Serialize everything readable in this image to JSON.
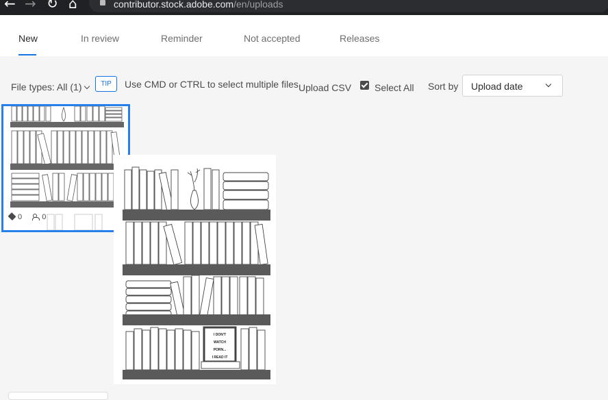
{
  "browser": {
    "url_host": "contributor.stock.adobe.com",
    "url_path": "/en/uploads",
    "back_glyph": "←",
    "forward_glyph": "→",
    "reload_glyph": "↻",
    "home_glyph": "⌂"
  },
  "tabs": [
    {
      "label": "New",
      "active": true
    },
    {
      "label": "In review",
      "active": false
    },
    {
      "label": "Reminder",
      "active": false
    },
    {
      "label": "Not accepted",
      "active": false
    },
    {
      "label": "Releases",
      "active": false
    }
  ],
  "toolbar": {
    "file_types_label": "File types: All (1)",
    "tip_label": "TIP",
    "tip_text": "Use CMD or CTRL to select multiple files",
    "upload_csv_label": "Upload CSV",
    "select_all_label": "Select All",
    "select_all_checked": true,
    "sort_by_label": "Sort by",
    "sort_value": "Upload date"
  },
  "thumbnail": {
    "keywords_count": "0",
    "releases_count": "0",
    "selected": true
  },
  "preview": {
    "sign_text": [
      "I DON'T",
      "WATCH",
      "PORN...",
      "I READ IT"
    ]
  },
  "colors": {
    "accent": "#1473e6",
    "selection": "#2680eb",
    "background": "#f5f5f5"
  }
}
